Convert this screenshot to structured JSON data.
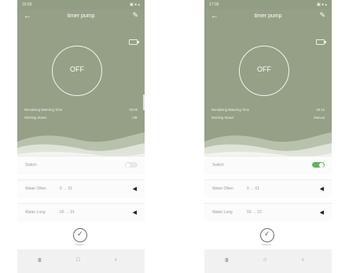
{
  "screens": [
    {
      "status_time": "16:55",
      "status_icons": "▣ ● ▴",
      "title": "timer pump",
      "dial_text": "OFF",
      "info": [
        {
          "label": "Remaining Watering Time",
          "value": "00:00"
        },
        {
          "label": "Working Status",
          "value": "Idle"
        }
      ],
      "rows": [
        {
          "label": "Switch",
          "value": "",
          "control": "toggle",
          "state": "off"
        },
        {
          "label": "Water Often",
          "value": "0 → 01",
          "control": "play"
        },
        {
          "label": "Water Long",
          "value": "00 → 01",
          "control": "play"
        }
      ],
      "confirm_label": "Confirm",
      "nav": [
        "Ⅲ",
        "□",
        "‹"
      ]
    },
    {
      "status_time": "17:05",
      "status_icons": "▣ ● ▴",
      "title": "timer pump",
      "dial_text": "OFF",
      "info": [
        {
          "label": "Remaining Watering Time",
          "value": "00:13"
        },
        {
          "label": "Working Status",
          "value": "Manual"
        }
      ],
      "rows": [
        {
          "label": "Switch",
          "value": "",
          "control": "toggle",
          "state": "on"
        },
        {
          "label": "Water Often",
          "value": "0 → 01",
          "control": "play"
        },
        {
          "label": "Water Long",
          "value": "00 → 15",
          "control": "play"
        }
      ],
      "confirm_label": "Confirm",
      "nav": [
        "Ⅲ",
        "○",
        "‹"
      ]
    }
  ],
  "icons": [
    "back-arrow-icon",
    "edit-pencil-icon",
    "battery-icon",
    "play-triangle-icon",
    "check-icon"
  ],
  "colors": {
    "header": "#95a086",
    "toggle_on": "#5eb45b"
  }
}
